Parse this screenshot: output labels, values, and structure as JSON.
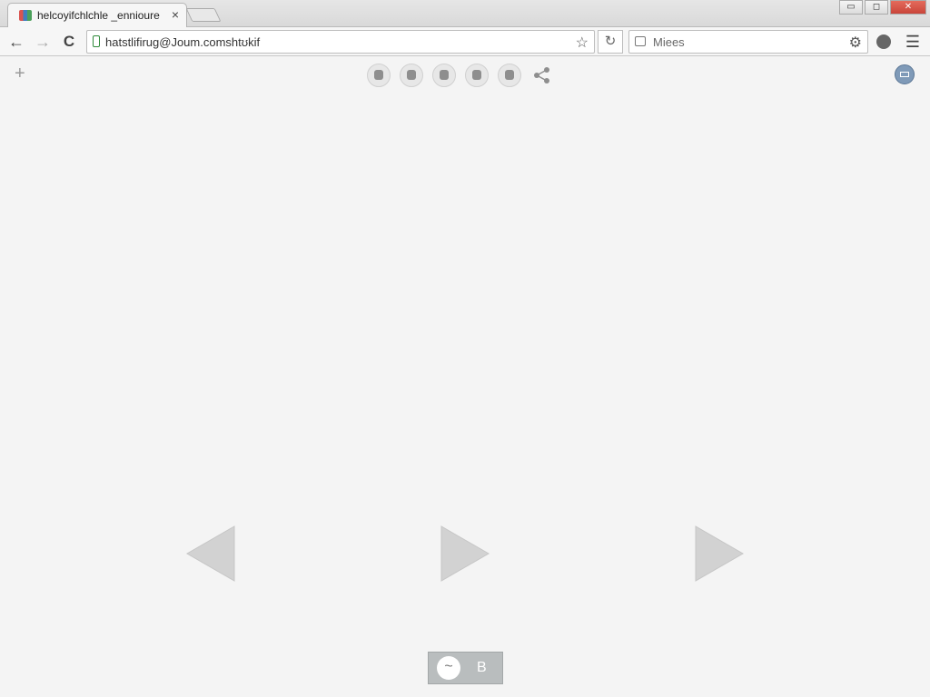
{
  "tab": {
    "title": "helcoyifchlchle _ennioure",
    "close": "×"
  },
  "window": {
    "minimize": "▭",
    "maximize": "◻",
    "close": "✕"
  },
  "toolbar": {
    "back": "←",
    "forward": "→",
    "reload": "C",
    "url": "hatstlifirug@Joum.comshtʊkif",
    "star": "☆",
    "refresh_alt": "↻",
    "search_placeholder": "Miees",
    "gear": "⚙",
    "menu": "☰"
  },
  "content": {
    "plus": "+",
    "bottom_toggle": "~",
    "bottom_label": "B"
  },
  "colors": {
    "lock_green": "#2f8a3a",
    "arrow_gray": "#cfcfcf",
    "bottom_panel": "#b9bdbe"
  }
}
